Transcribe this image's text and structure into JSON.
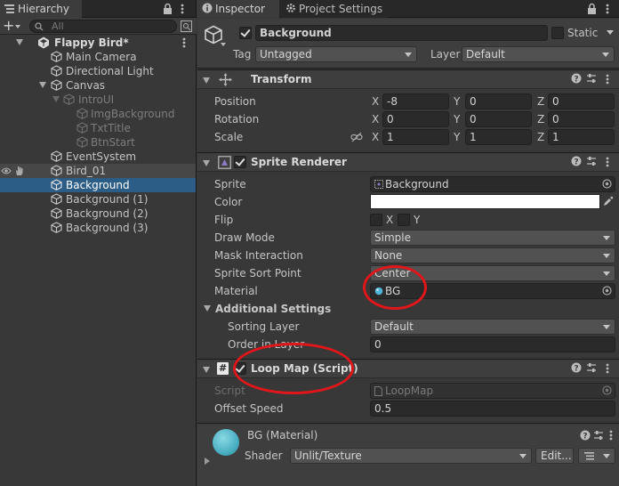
{
  "hierarchy": {
    "tab_label": "Hierarchy",
    "search_placeholder": "All",
    "add_label": "+",
    "items": [
      {
        "label": "Flappy Bird*"
      },
      {
        "label": "Main Camera"
      },
      {
        "label": "Directional Light"
      },
      {
        "label": "Canvas"
      },
      {
        "label": "IntroUI"
      },
      {
        "label": "ImgBackground"
      },
      {
        "label": "TxtTitle"
      },
      {
        "label": "BtnStart"
      },
      {
        "label": "EventSystem"
      },
      {
        "label": "Bird_01"
      },
      {
        "label": "Background"
      },
      {
        "label": "Background (1)"
      },
      {
        "label": "Background (2)"
      },
      {
        "label": "Background (3)"
      }
    ]
  },
  "inspector": {
    "tab_inspector": "Inspector",
    "tab_project_settings": "Project Settings",
    "object_name": "Background",
    "static_label": "Static",
    "tag_label": "Tag",
    "tag_value": "Untagged",
    "layer_label": "Layer",
    "layer_value": "Default",
    "transform": {
      "title": "Transform",
      "position_label": "Position",
      "rotation_label": "Rotation",
      "scale_label": "Scale",
      "x": "X",
      "y": "Y",
      "z": "Z",
      "position": [
        "-8",
        "0",
        "0"
      ],
      "rotation": [
        "0",
        "0",
        "0"
      ],
      "scale": [
        "1",
        "1",
        "1"
      ]
    },
    "sprite_renderer": {
      "title": "Sprite Renderer",
      "sprite_label": "Sprite",
      "sprite_value": "Background",
      "color_label": "Color",
      "color_value": "#ffffff",
      "flip_label": "Flip",
      "flip_x": "X",
      "flip_y": "Y",
      "draw_mode_label": "Draw Mode",
      "draw_mode_value": "Simple",
      "mask_label": "Mask Interaction",
      "mask_value": "None",
      "sort_point_label": "Sprite Sort Point",
      "sort_point_value": "Center",
      "material_label": "Material",
      "material_value": "BG",
      "additional_label": "Additional Settings",
      "sorting_layer_label": "Sorting Layer",
      "sorting_layer_value": "Default",
      "order_label": "Order in Layer",
      "order_value": "0"
    },
    "loop_map": {
      "title": "Loop Map (Script)",
      "script_label": "Script",
      "script_value": "LoopMap",
      "offset_label": "Offset Speed",
      "offset_value": "0.5"
    },
    "material": {
      "title": "BG (Material)",
      "shader_label": "Shader",
      "shader_value": "Unlit/Texture",
      "edit_label": "Edit..."
    }
  }
}
